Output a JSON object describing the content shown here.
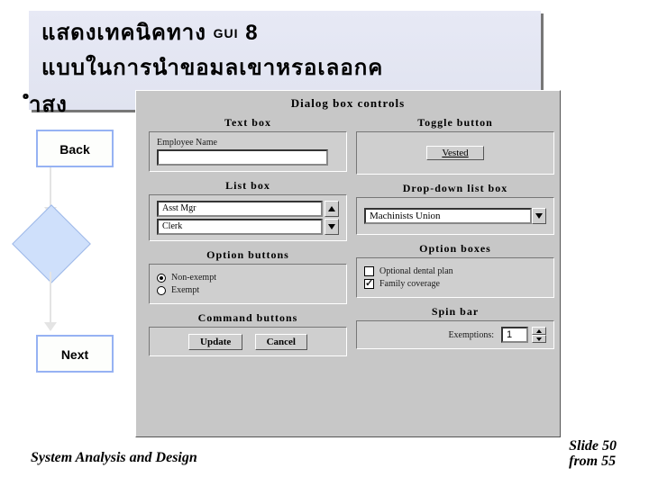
{
  "title": {
    "line1a": "แสดงเทคนิคทาง",
    "gui": "GUI",
    "line1b": "8",
    "line2": "แบบในการนำขอมลเขาหรอเลอกค",
    "line3": "ำสง"
  },
  "flow": {
    "back": "Back",
    "next": "Next"
  },
  "panel": {
    "title": "Dialog box controls",
    "textbox": {
      "label": "Text box",
      "field": "Employee Name"
    },
    "toggle": {
      "label": "Toggle button",
      "value": "Vested"
    },
    "listbox": {
      "label": "List box",
      "items": [
        "Asst Mgr",
        "Clerk"
      ]
    },
    "dropdown": {
      "label": "Drop-down list box",
      "value": "Machinists Union"
    },
    "radios": {
      "label": "Option buttons",
      "opt1": "Non-exempt",
      "opt2": "Exempt"
    },
    "checks": {
      "label": "Option boxes",
      "opt1": "Optional dental plan",
      "opt2": "Family coverage"
    },
    "cmd": {
      "label": "Command buttons",
      "btn1": "Update",
      "btn2": "Cancel"
    },
    "spin": {
      "label": "Spin bar",
      "caption": "Exemptions:",
      "value": "1"
    }
  },
  "footer": {
    "left": "System Analysis and Design",
    "r1": "Slide 50",
    "r2": "from 55"
  }
}
